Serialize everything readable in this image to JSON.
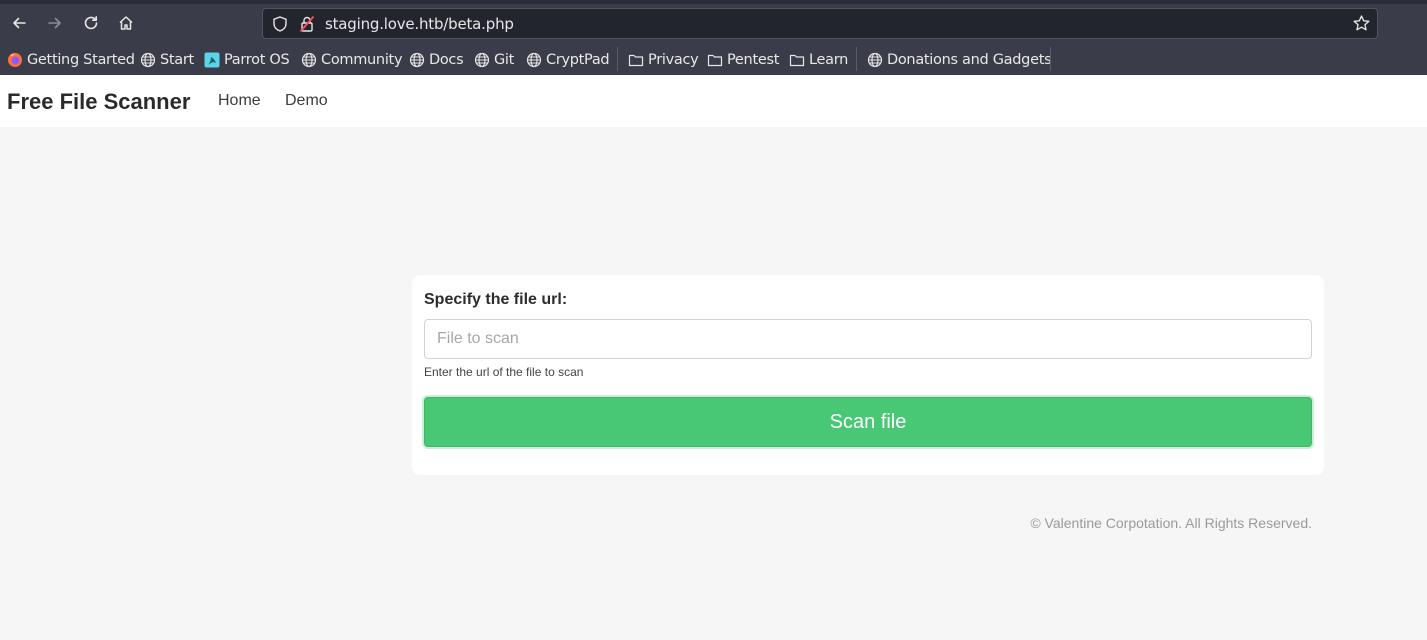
{
  "browser": {
    "url": "staging.love.htb/beta.php",
    "bookmarks": [
      {
        "label": "Getting Started",
        "icon": "firefox-icon"
      },
      {
        "label": "Start",
        "icon": "globe-icon"
      },
      {
        "label": "Parrot OS",
        "icon": "parrot-icon"
      },
      {
        "label": "Community",
        "icon": "globe-icon"
      },
      {
        "label": "Docs",
        "icon": "globe-icon"
      },
      {
        "label": "Git",
        "icon": "globe-icon"
      },
      {
        "label": "CryptPad",
        "icon": "globe-icon"
      },
      {
        "label": "Privacy",
        "icon": "folder-icon"
      },
      {
        "label": "Pentest",
        "icon": "folder-icon"
      },
      {
        "label": "Learn",
        "icon": "folder-icon"
      },
      {
        "label": "Donations and Gadgets",
        "icon": "globe-icon"
      }
    ]
  },
  "navbar": {
    "brand": "Free File Scanner",
    "links": [
      "Home",
      "Demo"
    ]
  },
  "form": {
    "label": "Specify the file url:",
    "input_placeholder": "File to scan",
    "input_value": "",
    "hint": "Enter the url of the file to scan",
    "button_label": "Scan file"
  },
  "footer": {
    "text": "© Valentine Corpotation. All Rights Reserved."
  },
  "colors": {
    "accent": "#48c774",
    "chrome": "#3a3d49",
    "page_bg": "#f6f6f6"
  }
}
